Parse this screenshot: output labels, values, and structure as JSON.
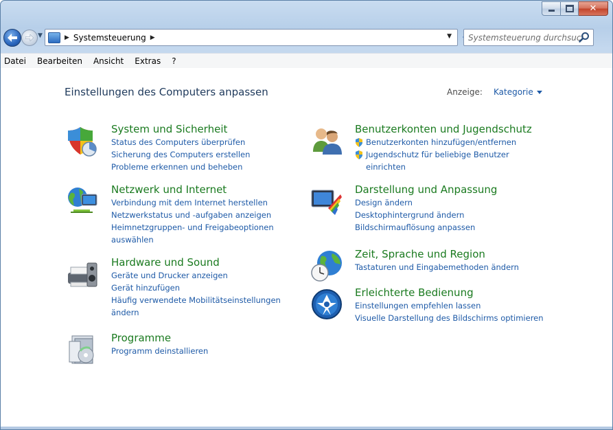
{
  "window": {
    "controls": {
      "minimize": "minimize",
      "maximize": "maximize",
      "close": "close"
    }
  },
  "address": {
    "path": "Systemsteuerung",
    "search_placeholder": "Systemsteuerung durchsuch..."
  },
  "menu": [
    "Datei",
    "Bearbeiten",
    "Ansicht",
    "Extras",
    "?"
  ],
  "page": {
    "title": "Einstellungen des Computers anpassen",
    "view_label": "Anzeige:",
    "view_value": "Kategorie"
  },
  "categories": {
    "system": {
      "title": "System und Sicherheit",
      "icon": "shield-icon",
      "links": [
        "Status des Computers überprüfen",
        "Sicherung des Computers erstellen",
        "Probleme erkennen und beheben"
      ]
    },
    "network": {
      "title": "Netzwerk und Internet",
      "icon": "network-globe-icon",
      "links": [
        "Verbindung mit dem Internet herstellen",
        "Netzwerkstatus und -aufgaben anzeigen",
        "Heimnetzgruppen- und Freigabeoptionen",
        "auswählen"
      ]
    },
    "hardware": {
      "title": "Hardware und Sound",
      "icon": "printer-speaker-icon",
      "links": [
        "Geräte und Drucker anzeigen",
        "Gerät hinzufügen",
        "Häufig verwendete Mobilitätseinstellungen",
        "ändern"
      ]
    },
    "programs": {
      "title": "Programme",
      "icon": "programs-disc-icon",
      "links": [
        "Programm deinstallieren"
      ]
    },
    "users": {
      "title": "Benutzerkonten und Jugendschutz",
      "icon": "users-icon",
      "links": [
        "Benutzerkonten hinzufügen/entfernen",
        "Jugendschutz für beliebige Benutzer",
        "einrichten"
      ]
    },
    "appearance": {
      "title": "Darstellung und Anpassung",
      "icon": "monitor-palette-icon",
      "links": [
        "Design ändern",
        "Desktophintergrund ändern",
        "Bildschirmauflösung anpassen"
      ]
    },
    "region": {
      "title": "Zeit, Sprache und Region",
      "icon": "globe-clock-icon",
      "links": [
        "Tastaturen und Eingabemethoden ändern"
      ]
    },
    "access": {
      "title": "Erleichterte Bedienung",
      "icon": "ease-of-access-icon",
      "links": [
        "Einstellungen empfehlen lassen",
        "Visuelle Darstellung des Bildschirms optimieren"
      ]
    }
  },
  "colors": {
    "category_title": "#1a7a1f",
    "link": "#1e5aa7",
    "page_title": "#1e395b"
  }
}
